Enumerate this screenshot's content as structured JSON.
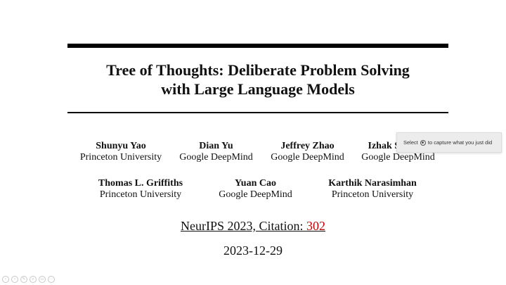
{
  "slide": {
    "title_line1": "Tree of Thoughts: Deliberate Problem Solving",
    "title_line2": "with Large Language Models",
    "authors": [
      {
        "name": "Shunyu Yao",
        "affiliation": "Princeton University"
      },
      {
        "name": "Dian Yu",
        "affiliation": "Google DeepMind"
      },
      {
        "name": "Jeffrey Zhao",
        "affiliation": "Google DeepMind"
      },
      {
        "name": "Izhak Shafran",
        "affiliation": "Google DeepMind"
      },
      {
        "name": "Thomas L. Griffiths",
        "affiliation": "Princeton University"
      },
      {
        "name": "Yuan Cao",
        "affiliation": "Google DeepMind"
      },
      {
        "name": "Karthik Narasimhan",
        "affiliation": "Princeton University"
      }
    ],
    "venue_prefix": "NeurIPS 2023, Citation: ",
    "citation_count": "302",
    "date": "2023-12-29"
  },
  "tooltip": {
    "prefix": "Select",
    "icon": "keyboard-key-icon",
    "suffix": "to capture what you just did"
  },
  "toolbar": {
    "buttons": [
      {
        "icon": "previous-icon",
        "glyph": "‹"
      },
      {
        "icon": "next-icon",
        "glyph": "›"
      },
      {
        "icon": "pen-icon",
        "glyph": "✎"
      },
      {
        "icon": "zoom-icon",
        "glyph": "⌕"
      },
      {
        "icon": "slides-icon",
        "glyph": "▭"
      },
      {
        "icon": "more-icon",
        "glyph": "⋯"
      }
    ]
  }
}
